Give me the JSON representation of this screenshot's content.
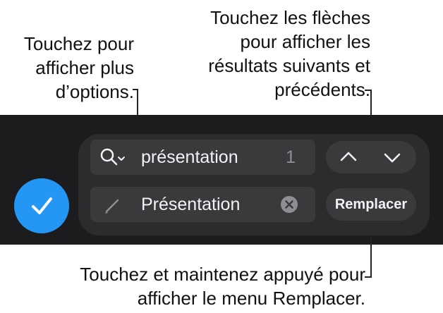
{
  "callouts": {
    "options": [
      "Touchez pour",
      "afficher plus",
      "d’options."
    ],
    "arrows": [
      "Touchez les flèches",
      "pour afficher les",
      "résultats suivants et",
      "précédents."
    ],
    "replace": [
      "Touchez et maintenez appuyé pour",
      "afficher le menu Remplacer."
    ]
  },
  "search": {
    "value": "présentation",
    "match_count": "1",
    "icon": "magnifier-with-chevron-icon"
  },
  "replace_field": {
    "value": "Présentation",
    "icon": "pencil-icon",
    "clear_icon": "clear-x-icon"
  },
  "buttons": {
    "replace_label": "Remplacer",
    "done_icon": "checkmark-icon",
    "prev_icon": "chevron-up-icon",
    "next_icon": "chevron-down-icon"
  },
  "colors": {
    "toolbar_bg": "#1c1c1e",
    "panel_bg": "#2c2c2e",
    "field_bg": "#3a3a3c",
    "accent": "#2496f3"
  }
}
